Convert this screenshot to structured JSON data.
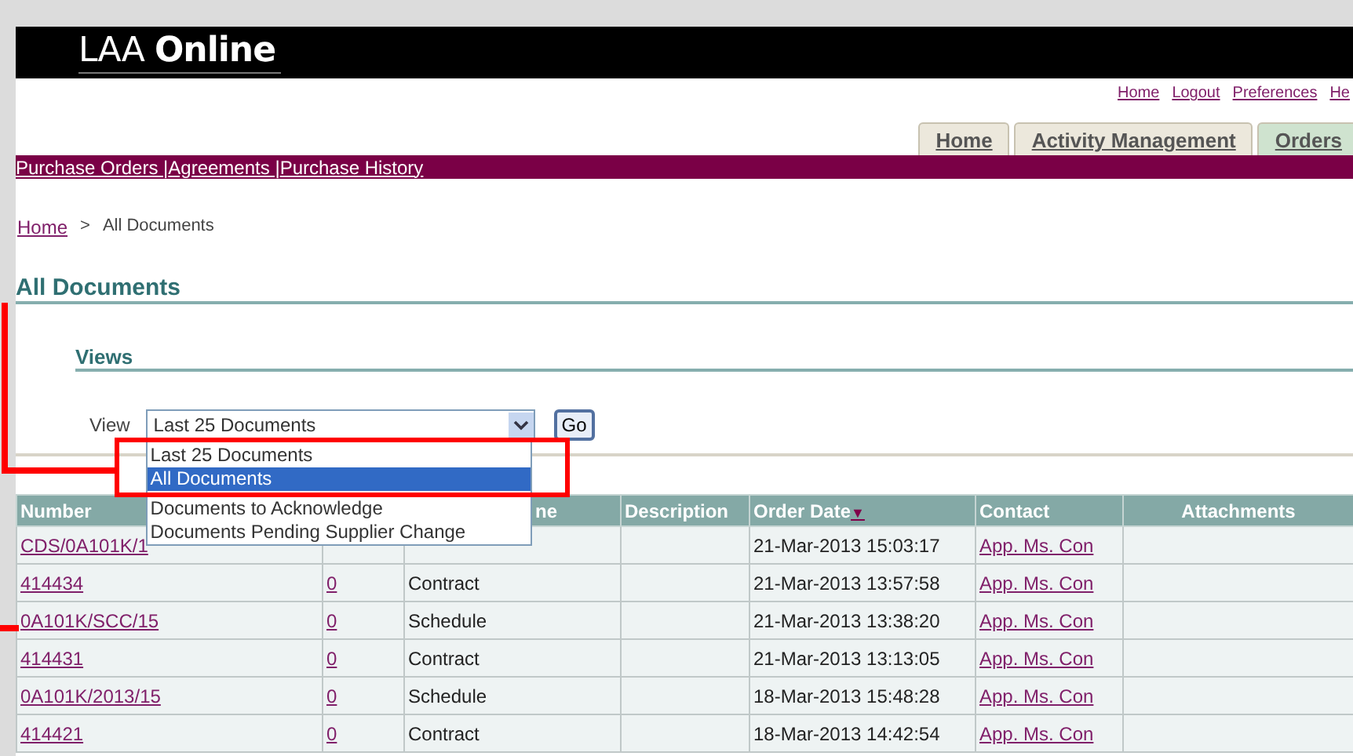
{
  "brand": {
    "prefix": "LAA",
    "name": "Online"
  },
  "global_links": [
    "Home",
    "Logout",
    "Preferences",
    "He"
  ],
  "tabs": [
    {
      "label": "Home",
      "selected": false
    },
    {
      "label": "Activity Management",
      "selected": false
    },
    {
      "label": "Orders",
      "selected": true
    }
  ],
  "subnav": [
    "Purchase Orders |",
    "Agreements |",
    "Purchase History"
  ],
  "breadcrumb": {
    "link": "Home",
    "separator": ">",
    "current": "All Documents"
  },
  "page_title": "All Documents",
  "section_title": "Views",
  "view": {
    "label": "View",
    "value": "Last 25 Documents",
    "go": "Go",
    "options": [
      {
        "label": "Last 25 Documents",
        "highlighted": false
      },
      {
        "label": "All Documents",
        "highlighted": true
      },
      {
        "label": "Documents to Acknowledge",
        "highlighted": false
      },
      {
        "label": "Documents Pending Supplier Change",
        "highlighted": false
      }
    ]
  },
  "table": {
    "columns": [
      {
        "label": "Number"
      },
      {},
      {
        "label": "ne"
      },
      {
        "label": "Description"
      },
      {
        "label": "Order Date",
        "sort": "▼"
      },
      {
        "label": "Contact"
      },
      {
        "label": "Attachments"
      }
    ],
    "rows": [
      {
        "number": "CDS/0A101K/1",
        "order_date": "21-Mar-2013 15:03:17",
        "contact": "App. Ms. Con"
      },
      {
        "number": "414434",
        "count": "0",
        "type": "Contract",
        "order_date": "21-Mar-2013 13:57:58",
        "contact": "App. Ms. Con"
      },
      {
        "number": "0A101K/SCC/15",
        "count": "0",
        "type": "Schedule",
        "order_date": "21-Mar-2013 13:38:20",
        "contact": "App. Ms. Con"
      },
      {
        "number": "414431",
        "count": "0",
        "type": "Contract",
        "order_date": "21-Mar-2013 13:13:05",
        "contact": "App. Ms. Con"
      },
      {
        "number": "0A101K/2013/15",
        "count": "0",
        "type": "Schedule",
        "order_date": "18-Mar-2013 15:48:28",
        "contact": "App. Ms. Con"
      },
      {
        "number": "414421",
        "count": "0",
        "type": "Contract",
        "order_date": "18-Mar-2013 14:42:54",
        "contact": "App. Ms. Con"
      }
    ]
  }
}
